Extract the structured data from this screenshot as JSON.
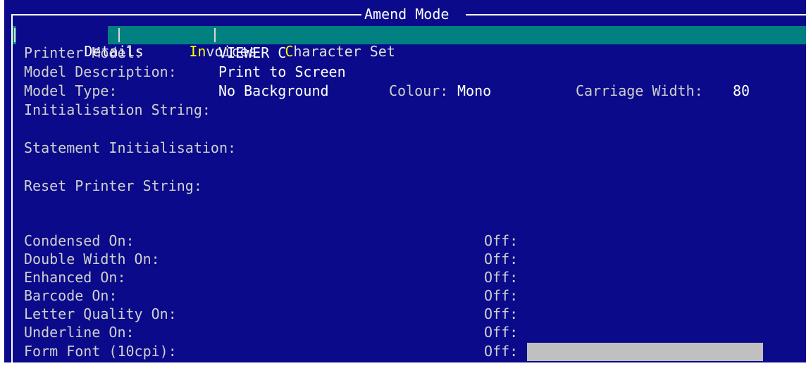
{
  "window": {
    "title": "Amend Mode"
  },
  "tabs": [
    {
      "hot": "D",
      "rest": "etails",
      "active": true
    },
    {
      "hot": "In",
      "rest": "voices",
      "active": false
    },
    {
      "hot": "C",
      "rest": "haracter Set",
      "active": false
    }
  ],
  "details": {
    "printer_model_label": "Printer Model:",
    "printer_model_value": "VIEWER C",
    "model_description_label": "Model Description:",
    "model_description_value": "Print to Screen",
    "model_type_label": "Model Type:",
    "model_type_value": "No Background",
    "colour_label": "Colour:",
    "colour_value": "Mono",
    "carriage_width_label": "Carriage Width:",
    "carriage_width_value": "80",
    "init_string_label": "Initialisation String:",
    "statement_init_label": "Statement Initialisation:",
    "reset_printer_label": "Reset Printer String:"
  },
  "codes": [
    {
      "on_label": "Condensed On:",
      "off_label": "Off:"
    },
    {
      "on_label": "Double Width On:",
      "off_label": "Off:"
    },
    {
      "on_label": "Enhanced On:",
      "off_label": "Off:"
    },
    {
      "on_label": "Barcode On:",
      "off_label": "Off:"
    },
    {
      "on_label": "Letter Quality On:",
      "off_label": "Off:"
    },
    {
      "on_label": "Underline On:",
      "off_label": "Off:"
    },
    {
      "on_label": "Form Font (10cpi):",
      "off_label": "Off:"
    }
  ],
  "colors": {
    "background": "#0a0a8a",
    "tab_bar": "#008080",
    "hotkey": "#ffff00",
    "input_field": "#c0c0c0"
  }
}
